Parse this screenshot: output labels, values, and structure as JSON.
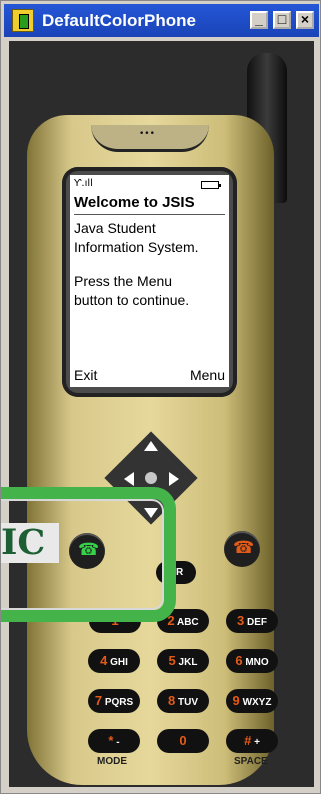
{
  "window": {
    "title": "DefaultColorPhone"
  },
  "title_buttons": {
    "minimize": "_",
    "maximize": "□",
    "close": "×"
  },
  "phone": {
    "status_icons": {
      "signal": "Ƴ.ıll",
      "battery": "battery-icon"
    },
    "screen_title": "Welcome to JSIS",
    "body": [
      "Java Student",
      "Information System.",
      "Press the Menu",
      "button to continue."
    ],
    "softkeys": {
      "left": "Exit",
      "right": "Menu"
    },
    "keys": [
      {
        "num": "1",
        "letters": ""
      },
      {
        "num": "2",
        "letters": "ABC"
      },
      {
        "num": "3",
        "letters": "DEF"
      },
      {
        "num": "4",
        "letters": "GHI"
      },
      {
        "num": "5",
        "letters": "JKL"
      },
      {
        "num": "6",
        "letters": "MNO"
      },
      {
        "num": "7",
        "letters": "PQRS"
      },
      {
        "num": "8",
        "letters": "TUV"
      },
      {
        "num": "9",
        "letters": "WXYZ"
      },
      {
        "num": "*",
        "letters": "-"
      },
      {
        "num": "0",
        "letters": ""
      },
      {
        "num": "#",
        "letters": "+"
      }
    ],
    "clear_key": "AR",
    "under_labels": {
      "mode": "MODE",
      "space": "SPACE"
    }
  },
  "overlay": {
    "text": "IC"
  },
  "colors": {
    "accent_green": "#44b34a",
    "phone_gold": "#d7c685",
    "end_orange": "#e45b17"
  }
}
